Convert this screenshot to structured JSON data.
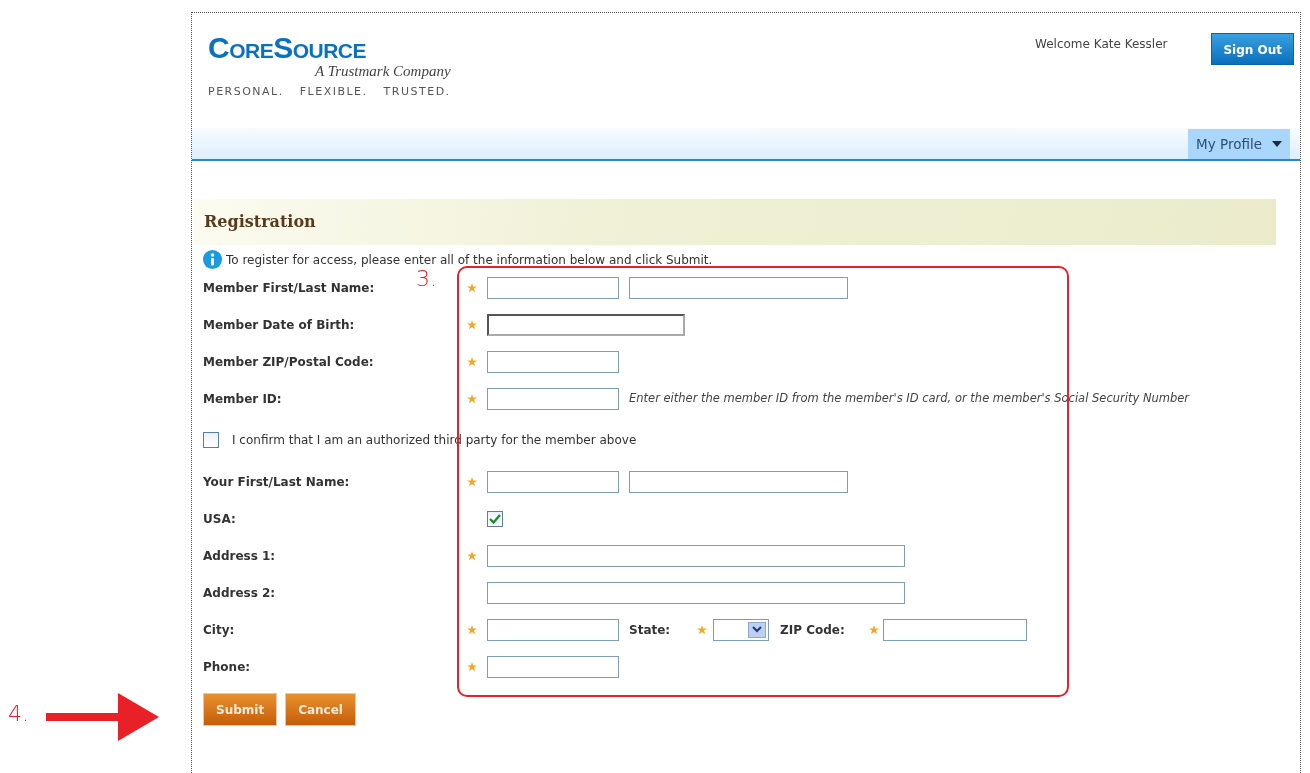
{
  "header": {
    "logo": {
      "name": "CoreSource",
      "tagline": "A Trustmark Company",
      "motto": [
        "PERSONAL.",
        "FLEXIBLE.",
        "TRUSTED."
      ]
    },
    "welcome": "Welcome Kate Kessler",
    "sign_out": "Sign Out"
  },
  "nav": {
    "menu": "My Profile"
  },
  "form": {
    "title": "Registration",
    "info": "To register for access, please enter all of the information below and click Submit.",
    "rows": [
      {
        "kind": "name",
        "label": "Member First/Last Name:",
        "required": true
      },
      {
        "kind": "date",
        "label": "Member Date of Birth:",
        "required": true
      },
      {
        "kind": "text",
        "label": "Member ZIP/Postal Code:",
        "required": true
      },
      {
        "kind": "text",
        "label": "Member ID:",
        "required": true,
        "hint": "Enter either the member ID from the member's ID card, or the member's Social Security Number"
      },
      {
        "kind": "confirm",
        "label": "I confirm that I am an authorized third party for the member above",
        "checked": false
      },
      {
        "kind": "name",
        "label": "Your First/Last Name:",
        "required": true
      },
      {
        "kind": "check",
        "label": "USA:",
        "checked": true
      },
      {
        "kind": "long",
        "label": "Address 1:",
        "required": true
      },
      {
        "kind": "long",
        "label": "Address 2:",
        "required": false
      },
      {
        "kind": "city",
        "label": "City:",
        "required": true,
        "state_label": "State:",
        "zip_label": "ZIP Code:"
      },
      {
        "kind": "text",
        "label": "Phone:",
        "required": true
      }
    ],
    "buttons": [
      "Submit",
      "Cancel"
    ]
  },
  "annotations": [
    {
      "label": "3."
    },
    {
      "label": "4."
    }
  ]
}
